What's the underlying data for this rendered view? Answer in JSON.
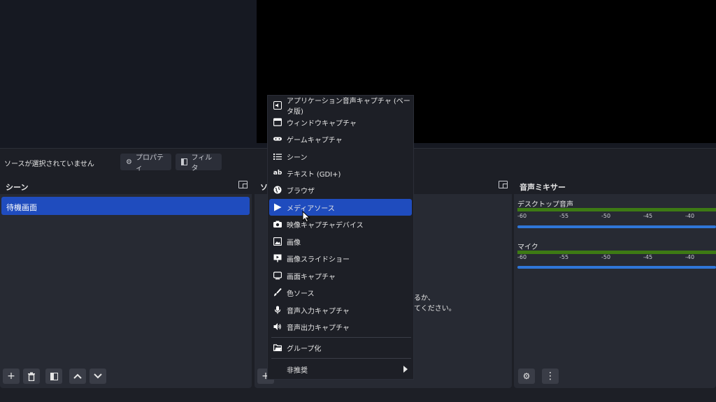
{
  "source_bar": {
    "status_text": "ソースが選択されていません",
    "properties_label": "プロパティ",
    "filters_label": "フィルタ"
  },
  "scenes": {
    "title": "シーン",
    "items": [
      "待機画面"
    ]
  },
  "sources": {
    "title": "ソ",
    "hint_line1": "るか、",
    "hint_line2": "てください。"
  },
  "mixer": {
    "title": "音声ミキサー",
    "channels": [
      {
        "name": "デスクトップ音声"
      },
      {
        "name": "マイク"
      }
    ],
    "ticks": [
      "-60",
      "-55",
      "-50",
      "-45",
      "-40"
    ]
  },
  "context_menu": {
    "items": [
      {
        "label": "アプリケーション音声キャプチャ (ベータ版)",
        "icon": "speaker-icon"
      },
      {
        "label": "ウィンドウキャプチャ",
        "icon": "window-icon"
      },
      {
        "label": "ゲームキャプチャ",
        "icon": "gamepad-icon"
      },
      {
        "label": "シーン",
        "icon": "list-icon"
      },
      {
        "label": "テキスト (GDI+)",
        "icon": "text-icon"
      },
      {
        "label": "ブラウザ",
        "icon": "globe-icon"
      },
      {
        "label": "メディアソース",
        "icon": "play-icon"
      },
      {
        "label": "映像キャプチャデバイス",
        "icon": "camera-icon"
      },
      {
        "label": "画像",
        "icon": "image-icon"
      },
      {
        "label": "画像スライドショー",
        "icon": "slideshow-icon"
      },
      {
        "label": "画面キャプチャ",
        "icon": "monitor-icon"
      },
      {
        "label": "色ソース",
        "icon": "brush-icon"
      },
      {
        "label": "音声入力キャプチャ",
        "icon": "microphone-icon"
      },
      {
        "label": "音声出力キャプチャ",
        "icon": "speaker-output-icon"
      }
    ],
    "group_label": "グループ化",
    "deprecated_label": "非推奨"
  },
  "colors": {
    "accent": "#1f4cbe",
    "panel": "#272a33",
    "background": "#1d1f26",
    "meter_green": "#3d7a14",
    "slider_blue": "#2f76d8"
  }
}
